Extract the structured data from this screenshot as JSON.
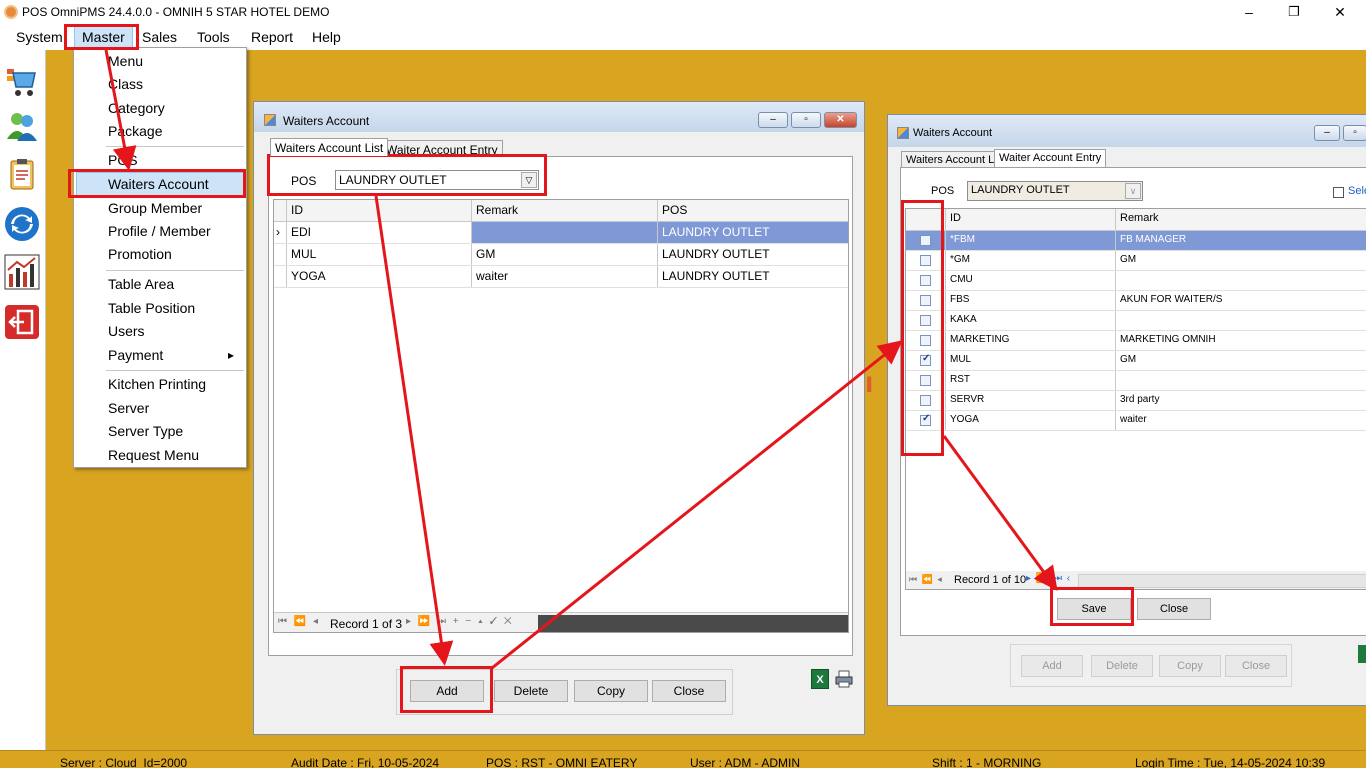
{
  "app": {
    "title": "POS OmniPMS 24.4.0.0 - OMNIH 5 STAR HOTEL DEMO",
    "minimize": "–",
    "restore": "❐",
    "close": "✕"
  },
  "menu": {
    "items": [
      "System",
      "Master",
      "Sales",
      "Tools",
      "Report",
      "Help"
    ]
  },
  "dropdown": {
    "items": [
      "Menu",
      "Class",
      "Category",
      "Package",
      "POS",
      "Waiters Account",
      "Group Member",
      "Profile / Member",
      "Promotion",
      "Table Area",
      "Table Position",
      "Users",
      "Payment",
      "Kitchen Printing",
      "Server",
      "Server Type",
      "Request Menu"
    ],
    "submenu_arrow": "▸"
  },
  "sidebar": {
    "icons": [
      "cart-icon",
      "users-icon",
      "clipboard-icon",
      "sync-icon",
      "chart-icon",
      "exit-icon"
    ]
  },
  "window1": {
    "title": "Waiters Account",
    "tabs": [
      "Waiters Account List",
      "Waiter Account Entry"
    ],
    "pos_label": "POS",
    "pos_value": "LAUNDRY OUTLET",
    "columns": [
      "ID",
      "Remark",
      "POS"
    ],
    "rows": [
      [
        "EDI",
        "",
        "LAUNDRY OUTLET"
      ],
      [
        "MUL",
        "GM",
        "LAUNDRY OUTLET"
      ],
      [
        "YOGA",
        "waiter",
        "LAUNDRY OUTLET"
      ]
    ],
    "record": "Record 1 of 3",
    "buttons": [
      "Add",
      "Delete",
      "Copy",
      "Close"
    ]
  },
  "window2": {
    "title": "Waiters Account",
    "tabs": [
      "Waiters Account List",
      "Waiter Account Entry"
    ],
    "pos_label": "POS",
    "pos_value": "LAUNDRY OUTLET",
    "select_label": "Sele",
    "columns": [
      "ID",
      "Remark"
    ],
    "rows": [
      {
        "id": "*FBM",
        "remark": "FB MANAGER",
        "checked": false
      },
      {
        "id": "*GM",
        "remark": "GM",
        "checked": false
      },
      {
        "id": "CMU",
        "remark": "",
        "checked": false
      },
      {
        "id": "FBS",
        "remark": "AKUN FOR WAITER/S",
        "checked": false
      },
      {
        "id": "KAKA",
        "remark": "",
        "checked": false
      },
      {
        "id": "MARKETING",
        "remark": "MARKETING OMNIH",
        "checked": false
      },
      {
        "id": "MUL",
        "remark": "GM",
        "checked": true
      },
      {
        "id": "RST",
        "remark": "",
        "checked": false
      },
      {
        "id": "SERVR",
        "remark": "3rd party",
        "checked": false
      },
      {
        "id": "YOGA",
        "remark": "waiter",
        "checked": true
      }
    ],
    "record": "Record 1 of 10",
    "save": "Save",
    "close": "Close",
    "disabled_buttons": [
      "Add",
      "Delete",
      "Copy",
      "Close"
    ]
  },
  "status": {
    "server": "Server : Cloud_Id=2000",
    "audit": "Audit Date : Fri, 10-05-2024",
    "pos": "POS : RST - OMNI EATERY",
    "user": "User : ADM - ADMIN",
    "shift": "Shift : 1 - MORNING",
    "login": "Login Time : Tue, 14-05-2024 10:39"
  },
  "colors": {
    "background": "#d9a521",
    "annotation": "#e4161b",
    "selected_row": "#7f99d6",
    "dropdown_highlight": "#cde3f7"
  }
}
